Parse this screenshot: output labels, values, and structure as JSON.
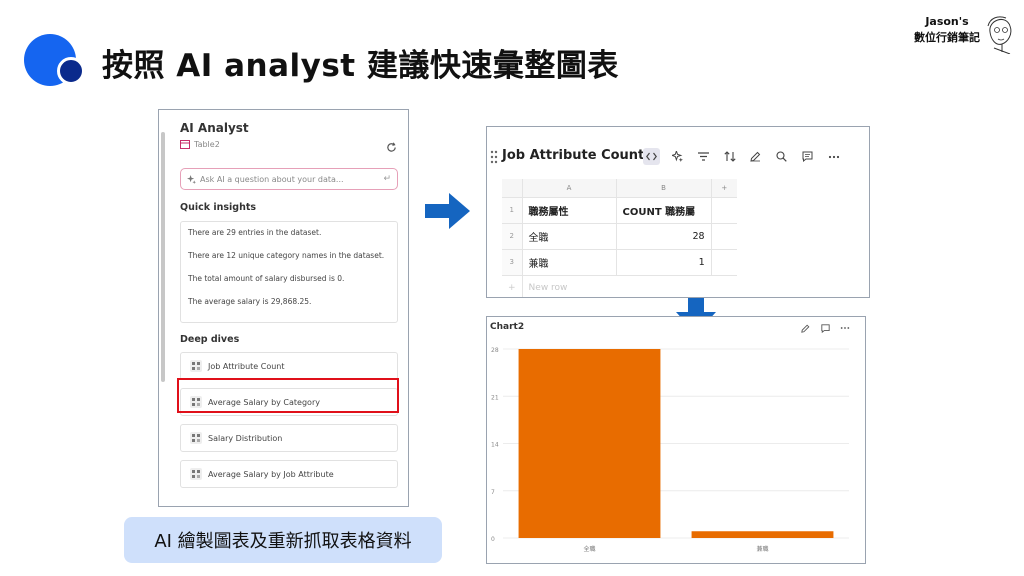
{
  "slide": {
    "title": "按照 AI analyst 建議快速彙整圖表",
    "brand_line1": "Jason's",
    "brand_line2": "數位行銷筆記",
    "caption": "AI 繪製圖表及重新抓取表格資料",
    "colors": {
      "primary": "#1565f0",
      "dark": "#0b2a8c",
      "arrow": "#1565c0",
      "highlight": "#e0101a",
      "caption_bg": "#cfe0fb"
    }
  },
  "ai_analyst": {
    "title": "AI Analyst",
    "table_name": "Table2",
    "ask_placeholder": "Ask AI a question about your data...",
    "quick_insights_label": "Quick insights",
    "insights": [
      "There are 29 entries in the dataset.",
      "There are 12 unique category names in the dataset.",
      "The total amount of salary disbursed is 0.",
      "The average salary is 29,868.25."
    ],
    "deep_dives_label": "Deep dives",
    "deep_dives": [
      "Job Attribute Count",
      "Average Salary by Category",
      "Salary Distribution",
      "Average Salary by Job Attribute"
    ]
  },
  "table_widget": {
    "title": "Job Attribute Count",
    "columns": [
      "A",
      "B"
    ],
    "add_col": "+",
    "rows": [
      {
        "n": "1",
        "a": "職務屬性",
        "b": "COUNT 職務屬"
      },
      {
        "n": "2",
        "a": "全職",
        "b": "28"
      },
      {
        "n": "3",
        "a": "兼職",
        "b": "1"
      }
    ],
    "new_row": "+",
    "new_row_label": "New row"
  },
  "chart_widget": {
    "title": "Chart2"
  },
  "chart_data": {
    "type": "bar",
    "title": "Chart2",
    "categories": [
      "全職",
      "兼職"
    ],
    "values": [
      28,
      1
    ],
    "ylim": [
      0,
      28
    ],
    "yticks": [
      0,
      7,
      14,
      21,
      28
    ],
    "grid": true,
    "bar_color": "#e86c00"
  }
}
